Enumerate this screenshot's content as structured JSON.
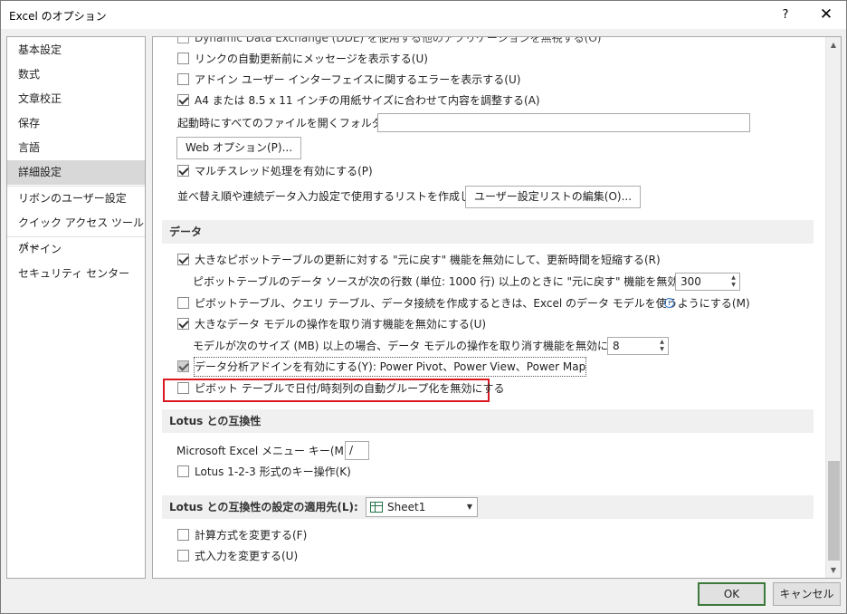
{
  "window": {
    "title": "Excel のオプション",
    "help": "?",
    "close": "✕"
  },
  "sidebar": {
    "items": [
      {
        "label": "基本設定"
      },
      {
        "label": "数式"
      },
      {
        "label": "文章校正"
      },
      {
        "label": "保存"
      },
      {
        "label": "言語"
      },
      {
        "label": "詳細設定",
        "active": true
      },
      {
        "label": "リボンのユーザー設定"
      },
      {
        "label": "クイック アクセス ツール バー"
      },
      {
        "label": "アドイン"
      },
      {
        "label": "セキュリティ センター"
      }
    ]
  },
  "content": {
    "top_partial": "Dynamic Data Exchange (DDE) を使用する他のアプリケーションを無視する(O)",
    "opt_link_prompt": {
      "label": "リンクの自動更新前にメッセージを表示する(U)",
      "checked": false
    },
    "opt_addin_errors": {
      "label": "アドイン ユーザー インターフェイスに関するエラーを表示する(U)",
      "checked": false
    },
    "opt_a4_scale": {
      "label": "A4 または 8.5 x 11 インチの用紙サイズに合わせて内容を調整する(A)",
      "checked": true
    },
    "startup_folder": {
      "label": "起動時にすべてのファイルを開くフォルダー(L):",
      "value": ""
    },
    "web_options_button": "Web オプション(P)...",
    "opt_multithread": {
      "label": "マルチスレッド処理を有効にする(P)",
      "checked": true
    },
    "custom_lists": {
      "label": "並べ替え順や連続データ入力設定で使用するリストを作成します:",
      "button": "ユーザー設定リストの編集(O)..."
    },
    "data_section": {
      "title": "データ"
    },
    "opt_pivot_undo": {
      "label": "大きなピボットテーブルの更新に対する \"元に戻す\" 機能を無効にして、更新時間を短縮する(R)",
      "checked": true
    },
    "pivot_rows": {
      "label": "ピボットテーブルのデータ ソースが次の行数 (単位: 1000 行) 以上のときに \"元に戻す\" 機能を無効にする(N):",
      "value": "300"
    },
    "opt_data_model": {
      "label": "ピボットテーブル、クエリ テーブル、データ接続を作成するときは、Excel のデータ モデルを使うようにする(M)",
      "checked": false,
      "info_icon": "i"
    },
    "opt_model_undo": {
      "label": "大きなデータ モデルの操作を取り消す機能を無効にする(U)",
      "checked": true
    },
    "model_size": {
      "label": "モデルが次のサイズ (MB) 以上の場合、データ モデルの操作を取り消す機能を無効にする(L):",
      "value": "8"
    },
    "opt_analysis_addins": {
      "label": "データ分析アドインを有効にする(Y): Power Pivot、Power View、Power Map",
      "checked": true
    },
    "opt_disable_grouping": {
      "label": "ピボット テーブルで日付/時刻列の自動グループ化を無効にする",
      "checked": false
    },
    "lotus_section": {
      "title": "Lotus との互換性"
    },
    "menu_key": {
      "label": "Microsoft Excel メニュー キー(M):",
      "value": "/"
    },
    "opt_lotus_keys": {
      "label": "Lotus 1-2-3 形式のキー操作(K)",
      "checked": false
    },
    "lotus_settings_section": {
      "title": "Lotus との互換性の設定の適用先(L):",
      "sheet": "Sheet1"
    },
    "opt_formula_eval": {
      "label": "計算方式を変更する(F)",
      "checked": false
    },
    "opt_formula_entry": {
      "label": "式入力を変更する(U)",
      "checked": false
    }
  },
  "footer": {
    "ok": "OK",
    "cancel": "キャンセル"
  },
  "colors": {
    "highlight_box": "#d9181f",
    "active_sidebar": "#d8d8d8",
    "excel_green": "#217346"
  }
}
